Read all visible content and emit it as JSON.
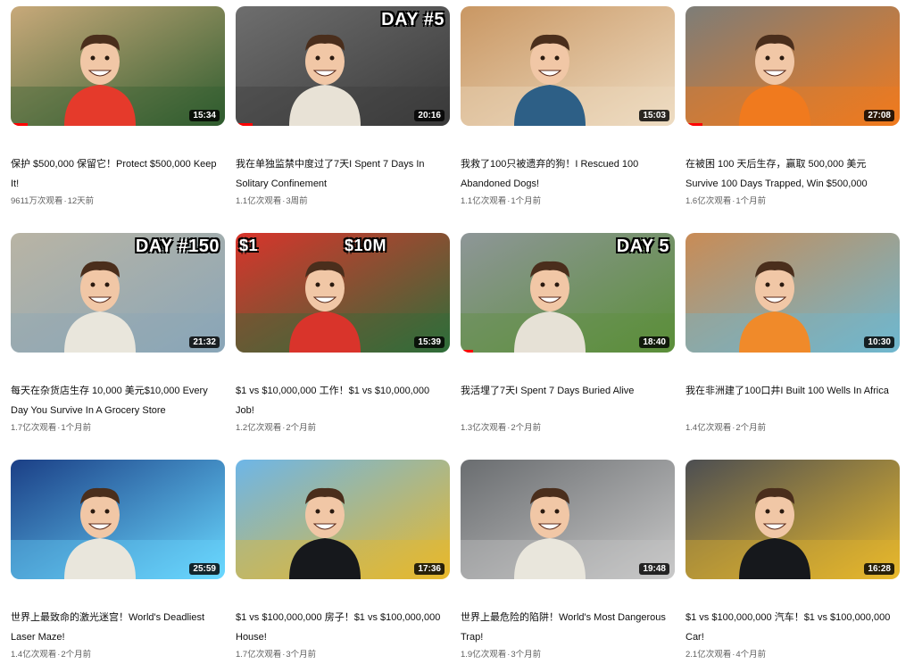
{
  "videos": [
    {
      "title": "保护 $500,000 保留它！Protect $500,000 Keep It!",
      "views": "9611万次观看",
      "age": "12天前",
      "duration": "15:34",
      "overlay": "",
      "progress_fraction": 0.08,
      "colors": {
        "bg": "#c8a97a",
        "accent": "#2f5d2f",
        "shirt": "#e53a2b"
      }
    },
    {
      "title": "我在单独监禁中度过了7天I Spent 7 Days In Solitary Confinement",
      "views": "1.1亿次观看",
      "age": "3周前",
      "duration": "20:16",
      "overlay": "DAY #5",
      "progress_fraction": 0.08,
      "colors": {
        "bg": "#6e6e6e",
        "accent": "#3a3a3a",
        "shirt": "#e8e2d6"
      }
    },
    {
      "title": "我救了100只被遗弃的狗！I Rescued 100 Abandoned Dogs!",
      "views": "1.1亿次观看",
      "age": "1个月前",
      "duration": "15:03",
      "overlay": "",
      "progress_fraction": 0,
      "colors": {
        "bg": "#c99763",
        "accent": "#eedcc2",
        "shirt": "#2d5f86"
      }
    },
    {
      "title": "在被困 100 天后生存，赢取 500,000 美元 Survive 100 Days Trapped, Win $500,000",
      "views": "1.6亿次观看",
      "age": "1个月前",
      "duration": "27:08",
      "overlay": "",
      "progress_fraction": 0.08,
      "colors": {
        "bg": "#7d7d78",
        "accent": "#f07a1e",
        "shirt": "#f07a1e"
      }
    },
    {
      "title": "每天在杂货店生存 10,000 美元$10,000 Every Day You Survive In A Grocery Store",
      "views": "1.7亿次观看",
      "age": "1个月前",
      "duration": "21:32",
      "overlay": "DAY #150",
      "progress_fraction": 0,
      "colors": {
        "bg": "#b9b4a4",
        "accent": "#8aa6b8",
        "shirt": "#e9e6dc"
      }
    },
    {
      "title": "$1 vs $10,000,000 工作！$1 vs $10,000,000 Job!",
      "views": "1.2亿次观看",
      "age": "2个月前",
      "duration": "15:39",
      "overlay": "$1",
      "overlay2": "$10M",
      "progress_fraction": 0,
      "colors": {
        "bg": "#d9342b",
        "accent": "#2f6e3a",
        "shirt": "#d9342b"
      }
    },
    {
      "title": "我活埋了7天I Spent 7 Days Buried Alive",
      "views": "1.3亿次观看",
      "age": "2个月前",
      "duration": "18:40",
      "overlay": "DAY 5",
      "progress_fraction": 0.06,
      "colors": {
        "bg": "#8e9698",
        "accent": "#5b8f3a",
        "shirt": "#e6e1d6"
      }
    },
    {
      "title": "我在非洲建了100口井I Built 100 Wells In Africa",
      "views": "1.4亿次观看",
      "age": "2个月前",
      "duration": "10:30",
      "overlay": "",
      "progress_fraction": 0,
      "colors": {
        "bg": "#c98b55",
        "accent": "#6fb7cf",
        "shirt": "#f08a2a"
      }
    },
    {
      "title": "世界上最致命的激光迷宫！World's Deadliest Laser Maze!",
      "views": "1.4亿次观看",
      "age": "2个月前",
      "duration": "25:59",
      "overlay": "",
      "progress_fraction": 0,
      "colors": {
        "bg": "#1b3f86",
        "accent": "#69d8ff",
        "shirt": "#e9e6dc"
      }
    },
    {
      "title": "$1 vs $100,000,000 房子！$1 vs $100,000,000 House!",
      "views": "1.7亿次观看",
      "age": "3个月前",
      "duration": "17:36",
      "overlay": "",
      "progress_fraction": 0,
      "colors": {
        "bg": "#6db6e8",
        "accent": "#e7b82c",
        "shirt": "#16181c"
      }
    },
    {
      "title": "世界上最危险的陷阱！World's Most Dangerous Trap!",
      "views": "1.9亿次观看",
      "age": "3个月前",
      "duration": "19:48",
      "overlay": "",
      "progress_fraction": 0,
      "colors": {
        "bg": "#6a6d70",
        "accent": "#c8c8c8",
        "shirt": "#e9e6dc"
      }
    },
    {
      "title": "$1 vs $100,000,000 汽车！$1 vs $100,000,000 Car!",
      "views": "2.1亿次观看",
      "age": "4个月前",
      "duration": "16:28",
      "overlay": "",
      "progress_fraction": 0,
      "colors": {
        "bg": "#4c4e52",
        "accent": "#e7b82c",
        "shirt": "#16181c"
      }
    }
  ],
  "separator": "·"
}
